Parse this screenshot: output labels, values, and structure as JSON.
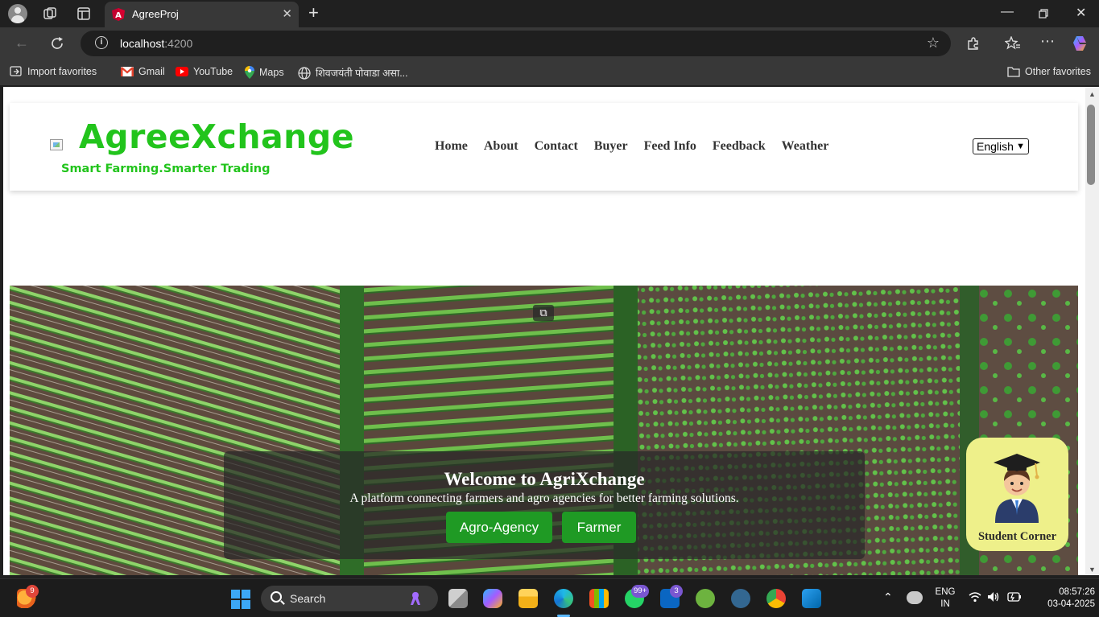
{
  "browser": {
    "tab_title": "AgreeProj",
    "url_host": "localhost",
    "url_port": ":4200",
    "favorites": [
      {
        "label": "Import favorites",
        "icon": "import-icon"
      },
      {
        "label": "Gmail",
        "icon": "gmail-icon"
      },
      {
        "label": "YouTube",
        "icon": "youtube-icon"
      },
      {
        "label": "Maps",
        "icon": "maps-icon"
      },
      {
        "label": "शिवजयंती पोवाडा असा...",
        "icon": "globe-icon"
      }
    ],
    "other_favorites": "Other favorites"
  },
  "site": {
    "brand": "AgreeXchange",
    "tagline": "Smart Farming.Smarter Trading",
    "nav": [
      "Home",
      "About",
      "Contact",
      "Buyer",
      "Feed Info",
      "Feedback",
      "Weather"
    ],
    "language": "English"
  },
  "hero": {
    "title": "Welcome to AgriXchange",
    "subtitle": "A platform connecting farmers and agro agencies for better farming solutions.",
    "btn_agro": "Agro-Agency",
    "btn_farmer": "Farmer"
  },
  "student_corner": "Student Corner",
  "taskbar": {
    "search": "Search",
    "weather_badge": "9",
    "whatsapp_badge": "99+",
    "linkedin_badge": "3",
    "lang_line1": "ENG",
    "lang_line2": "IN",
    "time": "08:57:26",
    "date": "03-04-2025"
  }
}
